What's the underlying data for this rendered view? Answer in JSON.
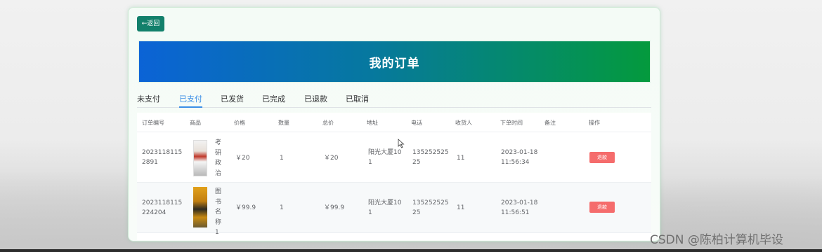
{
  "back_button": "←返回",
  "banner_title": "我的订单",
  "tabs": [
    "未支付",
    "已支付",
    "已发货",
    "已完成",
    "已退款",
    "已取消"
  ],
  "active_tab": "已支付",
  "table": {
    "headers": [
      "订单编号",
      "商品",
      "价格",
      "数量",
      "总价",
      "地址",
      "电话",
      "收货人",
      "下单时间",
      "备注",
      "操作"
    ],
    "rows": [
      {
        "order_no": [
          "2023118115",
          "2891"
        ],
        "product": "考研政治",
        "price": "￥20",
        "qty": "1",
        "total": "￥20",
        "address": [
          "阳光大厦10",
          "1"
        ],
        "phone": [
          "135252525",
          "25"
        ],
        "receiver": "11",
        "time": [
          "2023-01-18",
          "11:56:34"
        ],
        "note": "",
        "action": "退款"
      },
      {
        "order_no": [
          "2023118115",
          "224204"
        ],
        "product": "图书名称1",
        "price": "￥99.9",
        "qty": "1",
        "total": "￥99.9",
        "address": [
          "阳光大厦10",
          "1"
        ],
        "phone": [
          "135252525",
          "25"
        ],
        "receiver": "11",
        "time": [
          "2023-01-18",
          "11:56:51"
        ],
        "note": "",
        "action": "退款"
      }
    ]
  },
  "watermark": "CSDN @陈柏计算机毕设",
  "colors": {
    "accent_blue": "#3a8ee6",
    "back_button": "#12806b",
    "banner_start": "#0b63d6",
    "banner_end": "#049a3d",
    "refund_button": "#f56c6c"
  }
}
